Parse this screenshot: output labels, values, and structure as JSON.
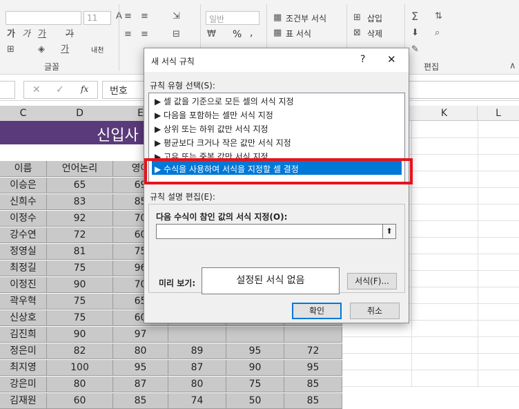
{
  "ribbon": {
    "font_size": "11",
    "number_format": "일반",
    "percent": "%",
    "comma": ",",
    "cond_format": "조건부 서식",
    "table_format": "표 서식",
    "cell_style": "셀 스타일",
    "insert": "삽입",
    "delete": "삭제",
    "format": "서식",
    "font_group": "글꼴",
    "edit_group": "편집",
    "phonetic": "내천"
  },
  "formula_bar": {
    "cancel": "✕",
    "enter": "✓",
    "fx": "fx",
    "value": "번호"
  },
  "columns": [
    {
      "label": "C",
      "selected": true
    },
    {
      "label": "D",
      "selected": true
    },
    {
      "label": "E",
      "selected": true
    },
    {
      "label": "K",
      "selected": false
    },
    {
      "label": "L",
      "selected": false
    }
  ],
  "sheet": {
    "title": "신입사",
    "headers": [
      "이름",
      "언어논리",
      "영어"
    ],
    "rows": [
      [
        "이승은",
        "65",
        "69",
        "",
        "",
        ""
      ],
      [
        "신희수",
        "83",
        "85",
        "",
        "",
        ""
      ],
      [
        "이정수",
        "92",
        "70",
        "",
        "",
        ""
      ],
      [
        "강수연",
        "72",
        "60",
        "",
        "",
        ""
      ],
      [
        "정영실",
        "81",
        "75",
        "",
        "",
        ""
      ],
      [
        "최정길",
        "75",
        "96",
        "",
        "",
        ""
      ],
      [
        "이정진",
        "90",
        "70",
        "",
        "",
        ""
      ],
      [
        "곽우혁",
        "75",
        "65",
        "",
        "",
        ""
      ],
      [
        "신상호",
        "75",
        "60",
        "",
        "",
        ""
      ],
      [
        "김진희",
        "90",
        "97",
        "",
        "",
        ""
      ],
      [
        "정은미",
        "82",
        "80",
        "89",
        "95",
        "72"
      ],
      [
        "최지영",
        "100",
        "95",
        "87",
        "90",
        "95"
      ],
      [
        "강은미",
        "80",
        "87",
        "80",
        "75",
        "85"
      ],
      [
        "김재원",
        "60",
        "85",
        "74",
        "50",
        "85"
      ]
    ]
  },
  "dialog": {
    "title": "새 서식 규칙",
    "help": "?",
    "close": "✕",
    "rule_type_label": "규칙 유형 선택(S):",
    "rules": [
      "▶ 셀 값을 기준으로 모든 셀의 서식 지정",
      "▶ 다음을 포함하는 셀만 서식 지정",
      "▶ 상위 또는 하위 값만 서식 지정",
      "▶ 평균보다 크거나 작은 값만 서식 지정",
      "▶ 고유 또는 중복 값만 서식 지정",
      "▶ 수식을 사용하여 서식을 지정할 셀 결정"
    ],
    "selected_rule_index": 5,
    "desc_label": "규칙 설명 편집(E):",
    "formula_label": "다음 수식이 참인 값의 서식 지정(O):",
    "formula_value": "",
    "collapse_icon": "⬆",
    "preview_label": "미리 보기:",
    "preview_text": "설정된 서식 없음",
    "format_button": "서식(F)...",
    "ok_button": "확인",
    "cancel_button": "취소",
    "highlight_color": "#e8121c",
    "selected_color": "#0078d7"
  }
}
